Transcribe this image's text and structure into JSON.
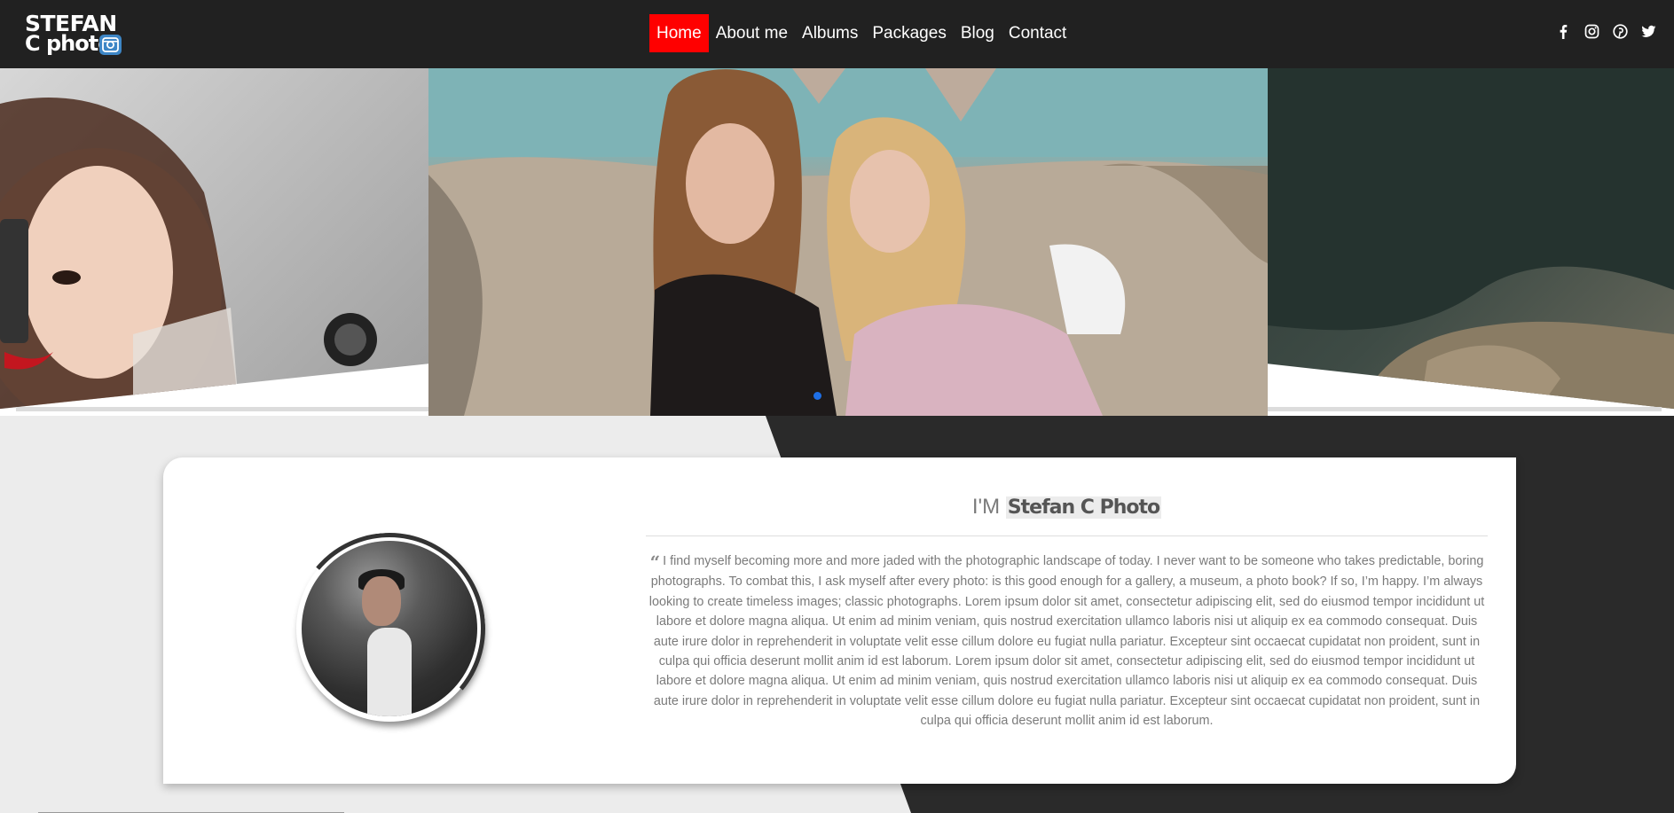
{
  "logo": {
    "line1": "STEFAN",
    "line2": "C photo",
    "badge_icon": "instagram-icon"
  },
  "nav": {
    "items": [
      {
        "label": "Home",
        "active": true
      },
      {
        "label": "About me",
        "active": false
      },
      {
        "label": "Albums",
        "active": false
      },
      {
        "label": "Packages",
        "active": false
      },
      {
        "label": "Blog",
        "active": false
      },
      {
        "label": "Contact",
        "active": false
      }
    ]
  },
  "social": [
    "facebook-icon",
    "instagram-icon",
    "pinterest-icon",
    "twitter-icon"
  ],
  "colors": {
    "header_bg": "#212121",
    "active_nav": "#ff0000",
    "dark_panel": "#2a2a2a",
    "page_bg": "#ececec",
    "indicator": "#1e6fe6"
  },
  "slider": {
    "slides": [
      "left-portrait-photo",
      "center-beach-photo",
      "right-rocks-photo"
    ],
    "active_index": 1
  },
  "about": {
    "prefix": "I'M",
    "name": "Stefan C Photo",
    "quote_icon": "quote-icon",
    "text": "I find myself becoming more and more jaded with the photographic landscape of today. I never want to be someone who takes predictable, boring photographs. To combat this, I ask myself after every photo: is this good enough for a gallery, a museum, a photo book? If so, I’m happy. I’m always looking to create timeless images; classic photographs. Lorem ipsum dolor sit amet, consectetur adipiscing elit, sed do eiusmod tempor incididunt ut labore et dolore magna aliqua. Ut enim ad minim veniam, quis nostrud exercitation ullamco laboris nisi ut aliquip ex ea commodo consequat. Duis aute irure dolor in reprehenderit in voluptate velit esse cillum dolore eu fugiat nulla pariatur. Excepteur sint occaecat cupidatat non proident, sunt in culpa qui officia deserunt mollit anim id est laborum. Lorem ipsum dolor sit amet, consectetur adipiscing elit, sed do eiusmod tempor incididunt ut labore et dolore magna aliqua. Ut enim ad minim veniam, quis nostrud exercitation ullamco laboris nisi ut aliquip ex ea commodo consequat. Duis aute irure dolor in reprehenderit in voluptate velit esse cillum dolore eu fugiat nulla pariatur. Excepteur sint occaecat cupidatat non proident, sunt in culpa qui officia deserunt mollit anim id est laborum."
  }
}
